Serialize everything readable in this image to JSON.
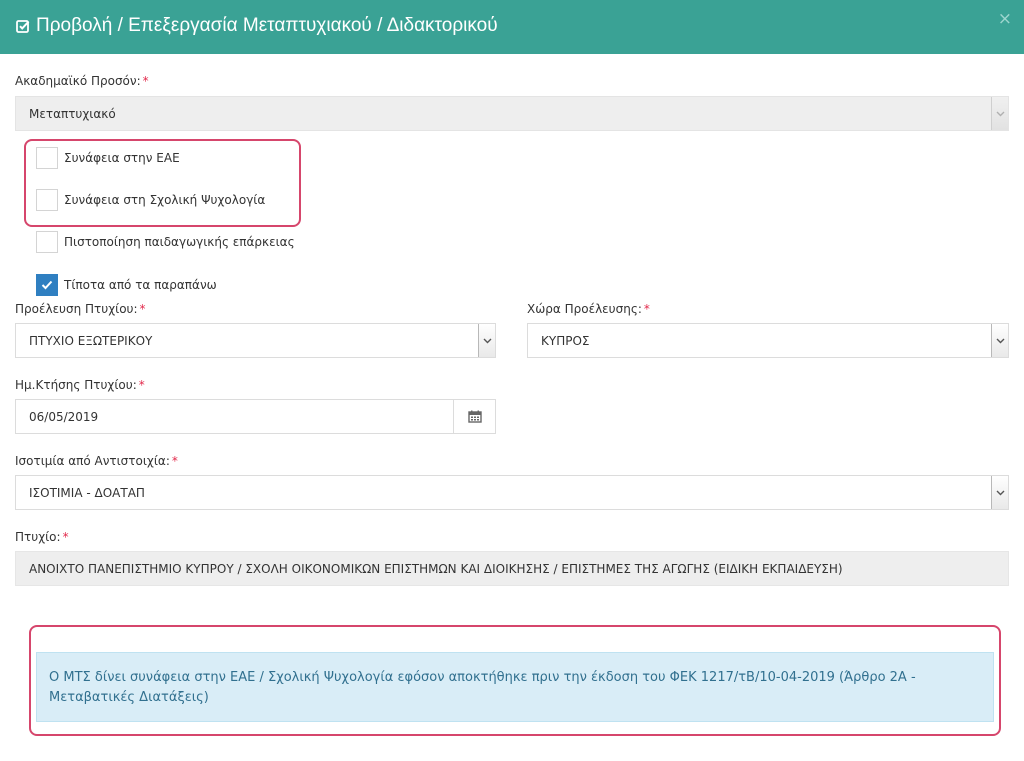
{
  "modal": {
    "title": "Προβολή / Επεξεργασία Μεταπτυχιακού / Διδακτορικού",
    "close_label": "×"
  },
  "form": {
    "required_mark": "*",
    "academic_qualification": {
      "label": "Ακαδημαϊκό Προσόν:",
      "value": "Μεταπτυχιακό"
    },
    "checkboxes": [
      {
        "label": "Συνάφεια στην ΕΑΕ",
        "checked": false
      },
      {
        "label": "Συνάφεια στη Σχολική Ψυχολογία",
        "checked": false
      },
      {
        "label": "Πιστοποίηση παιδαγωγικής επάρκειας",
        "checked": false
      },
      {
        "label": "Τίποτα από τα παραπάνω",
        "checked": true
      }
    ],
    "degree_origin": {
      "label": "Προέλευση Πτυχίου:",
      "value": "ΠΤΥΧΙΟ ΕΞΩΤΕΡΙΚΟΥ"
    },
    "country_origin": {
      "label": "Χώρα Προέλευσης:",
      "value": "ΚΥΠΡΟΣ"
    },
    "acquisition_date": {
      "label": "Ημ.Κτήσης Πτυχίου:",
      "value": "06/05/2019"
    },
    "equivalence": {
      "label": "Ισοτιμία από Αντιστοιχία:",
      "value": "ΙΣΟΤΙΜΙΑ - ΔΟΑΤΑΠ"
    },
    "degree": {
      "label": "Πτυχίο:",
      "value": "ΑΝΟΙΧΤΟ ΠΑΝΕΠΙΣΤΗΜΙΟ ΚΥΠΡΟΥ / ΣΧΟΛΗ ΟΙΚΟΝΟΜΙΚΩΝ ΕΠΙΣΤΗΜΩΝ ΚΑΙ ΔΙΟΙΚΗΣΗΣ / ΕΠΙΣΤΗΜΕΣ ΤΗΣ ΑΓΩΓΗΣ (ΕΙΔΙΚΗ ΕΚΠΑΙΔΕΥΣΗ)"
    }
  },
  "info_message": "Ο ΜΤΣ δίνει συνάφεια στην ΕΑΕ / Σχολική Ψυχολογία εφόσον αποκτήθηκε πριν την έκδοση του ΦΕΚ 1217/τΒ/10-04-2019 (Άρθρο 2Α - Μεταβατικές Διατάξεις)",
  "colors": {
    "header_bg": "#3aa295",
    "required": "#e2294b",
    "checkbox_checked": "#2f7fc1",
    "highlight_border": "#d6466c",
    "info_bg": "#d9edf7",
    "info_text": "#31708f"
  },
  "icons": {
    "title": "edit-check-icon",
    "close": "close-icon",
    "calendar": "calendar-icon",
    "dropdown": "chevron-down-icon",
    "checkmark": "checkmark-icon"
  }
}
